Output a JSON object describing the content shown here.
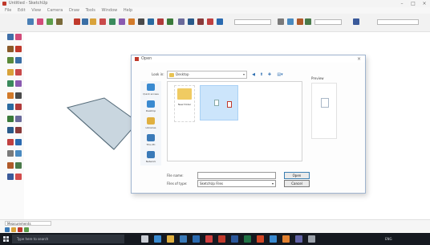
{
  "app": {
    "title": "Untitled - SketchUp"
  },
  "window_controls": {
    "minimize": "–",
    "maximize": "□",
    "close": "×"
  },
  "menu": [
    "File",
    "Edit",
    "View",
    "Camera",
    "Draw",
    "Tools",
    "Window",
    "Help"
  ],
  "toolbar": {
    "icons": [
      {
        "name": "select-tool-icon",
        "color": "#4a7fb5"
      },
      {
        "name": "eraser-tool-icon",
        "color": "#d24c7a"
      },
      {
        "name": "paint-tool-icon",
        "color": "#5c9e4a"
      },
      {
        "name": "line-tool-icon",
        "color": "#7a6a3a"
      },
      {
        "name": "arc-tool-icon",
        "color": "#c0392b"
      },
      {
        "name": "shape-tool-icon",
        "color": "#3a6ea5"
      },
      {
        "name": "push-pull-tool-icon",
        "color": "#d8a23a"
      },
      {
        "name": "move-tool-icon",
        "color": "#c94a4a"
      },
      {
        "name": "rotate-tool-icon",
        "color": "#3a8a5c"
      },
      {
        "name": "scale-tool-icon",
        "color": "#8a5ab0"
      },
      {
        "name": "offset-tool-icon",
        "color": "#d27a2a"
      },
      {
        "name": "tape-tool-icon",
        "color": "#4a4a4a"
      },
      {
        "name": "text-tool-icon",
        "color": "#2a6aa0"
      },
      {
        "name": "axes-tool-icon",
        "color": "#b03a3a"
      },
      {
        "name": "orbit-tool-icon",
        "color": "#3a7a3a"
      },
      {
        "name": "pan-tool-icon",
        "color": "#6a6a9a"
      },
      {
        "name": "zoom-tool-icon",
        "color": "#2a5a8a"
      },
      {
        "name": "zoom-extents-icon",
        "color": "#8a3a3a"
      },
      {
        "name": "warehouse-icon",
        "color": "#c04040"
      },
      {
        "name": "extension-icon",
        "color": "#2a6ab0"
      },
      {
        "name": "section-icon",
        "color": "#7a7a7a"
      },
      {
        "name": "styles-icon",
        "color": "#4a8ac0"
      },
      {
        "name": "layers-icon",
        "color": "#b05a2a"
      },
      {
        "name": "scenes-icon",
        "color": "#4a7a4a"
      },
      {
        "name": "shadows-icon",
        "color": "#3a5a9a"
      }
    ],
    "field1": "",
    "field2": "",
    "field3": ""
  },
  "palette": {
    "icons": [
      {
        "name": "palette-select-icon",
        "color": "#3f6fa8"
      },
      {
        "name": "palette-eraser-icon",
        "color": "#d24c7a"
      },
      {
        "name": "palette-line-icon",
        "color": "#8a5a2a"
      },
      {
        "name": "palette-arc-icon",
        "color": "#c0392b"
      },
      {
        "name": "palette-rectangle-icon",
        "color": "#5a8a3a"
      },
      {
        "name": "palette-circle-icon",
        "color": "#3a6ea5"
      },
      {
        "name": "palette-polygon-icon",
        "color": "#d8a23a"
      },
      {
        "name": "palette-pushpull-icon",
        "color": "#c94a4a"
      },
      {
        "name": "palette-move-icon",
        "color": "#3a8a5c"
      },
      {
        "name": "palette-rotate-icon",
        "color": "#8a5ab0"
      },
      {
        "name": "palette-scale-icon",
        "color": "#d27a2a"
      },
      {
        "name": "palette-offset-icon",
        "color": "#4a4a4a"
      },
      {
        "name": "palette-tape-icon",
        "color": "#2a6aa0"
      },
      {
        "name": "palette-protractor-icon",
        "color": "#b03a3a"
      },
      {
        "name": "palette-text-icon",
        "color": "#3a7a3a"
      },
      {
        "name": "palette-axes-icon",
        "color": "#6a6a9a"
      },
      {
        "name": "palette-dimension-icon",
        "color": "#2a5a8a"
      },
      {
        "name": "palette-orbit-icon",
        "color": "#8a3a3a"
      },
      {
        "name": "palette-pan-icon",
        "color": "#c04040"
      },
      {
        "name": "palette-zoom-icon",
        "color": "#2a6ab0"
      },
      {
        "name": "palette-zoom-window-icon",
        "color": "#7a7a7a"
      },
      {
        "name": "palette-walk-icon",
        "color": "#4a8ac0"
      },
      {
        "name": "palette-look-icon",
        "color": "#b05a2a"
      },
      {
        "name": "palette-section-icon",
        "color": "#4a7a4a"
      },
      {
        "name": "palette-paint-icon",
        "color": "#3a5a9a"
      },
      {
        "name": "palette-follow-me-icon",
        "color": "#d24c4c"
      }
    ]
  },
  "canvas": {
    "shape_fill": "#c9d6df",
    "shape_stroke": "#566c7a"
  },
  "dialog": {
    "title": "Open",
    "look_in_label": "Look in:",
    "look_in_value": "Desktop",
    "nav_back": "◀",
    "nav_up": "⬆",
    "nav_new": "✚",
    "nav_view": "▤▾",
    "places": [
      {
        "label": "Quick access",
        "icon": "star-icon",
        "color": "#3a8ad0"
      },
      {
        "label": "Desktop",
        "icon": "desktop-icon",
        "color": "#3a8ad0"
      },
      {
        "label": "Libraries",
        "icon": "libraries-icon",
        "color": "#e0b040"
      },
      {
        "label": "This PC",
        "icon": "this-pc-icon",
        "color": "#3a7ab8"
      },
      {
        "label": "Network",
        "icon": "network-icon",
        "color": "#3a7ab8"
      }
    ],
    "files": {
      "folder_label": "New folder",
      "selected_label": "",
      "doc1_label": "",
      "doc2_label": ""
    },
    "preview_label": "Preview",
    "preview_checkbox": "",
    "file_name_label": "File name:",
    "file_name_value": "",
    "file_type_label": "Files of type:",
    "file_type_value": "SketchUp Files",
    "open_button": "Open",
    "cancel_button": "Cancel"
  },
  "status": {
    "measurements_label": "Measurements",
    "hint": ""
  },
  "taskbar": {
    "search_placeholder": "Type here to search",
    "apps": [
      {
        "name": "task-view-icon",
        "color": "#c9cdd4"
      },
      {
        "name": "edge-icon",
        "color": "#3a8ad0"
      },
      {
        "name": "explorer-icon",
        "color": "#e0b040"
      },
      {
        "name": "store-icon",
        "color": "#3a7ab8"
      },
      {
        "name": "mail-icon",
        "color": "#2a6ab0"
      },
      {
        "name": "chrome-icon",
        "color": "#d04040"
      },
      {
        "name": "sketchup-icon",
        "color": "#c0392b"
      },
      {
        "name": "word-icon",
        "color": "#2b579a"
      },
      {
        "name": "excel-icon",
        "color": "#217346"
      },
      {
        "name": "powerpoint-icon",
        "color": "#d24726"
      },
      {
        "name": "photos-icon",
        "color": "#3a8ad0"
      },
      {
        "name": "media-icon",
        "color": "#e08030"
      },
      {
        "name": "teams-icon",
        "color": "#6264a7"
      },
      {
        "name": "settings-icon",
        "color": "#9aa0aa"
      }
    ],
    "clock": "",
    "lang": "ENG"
  }
}
